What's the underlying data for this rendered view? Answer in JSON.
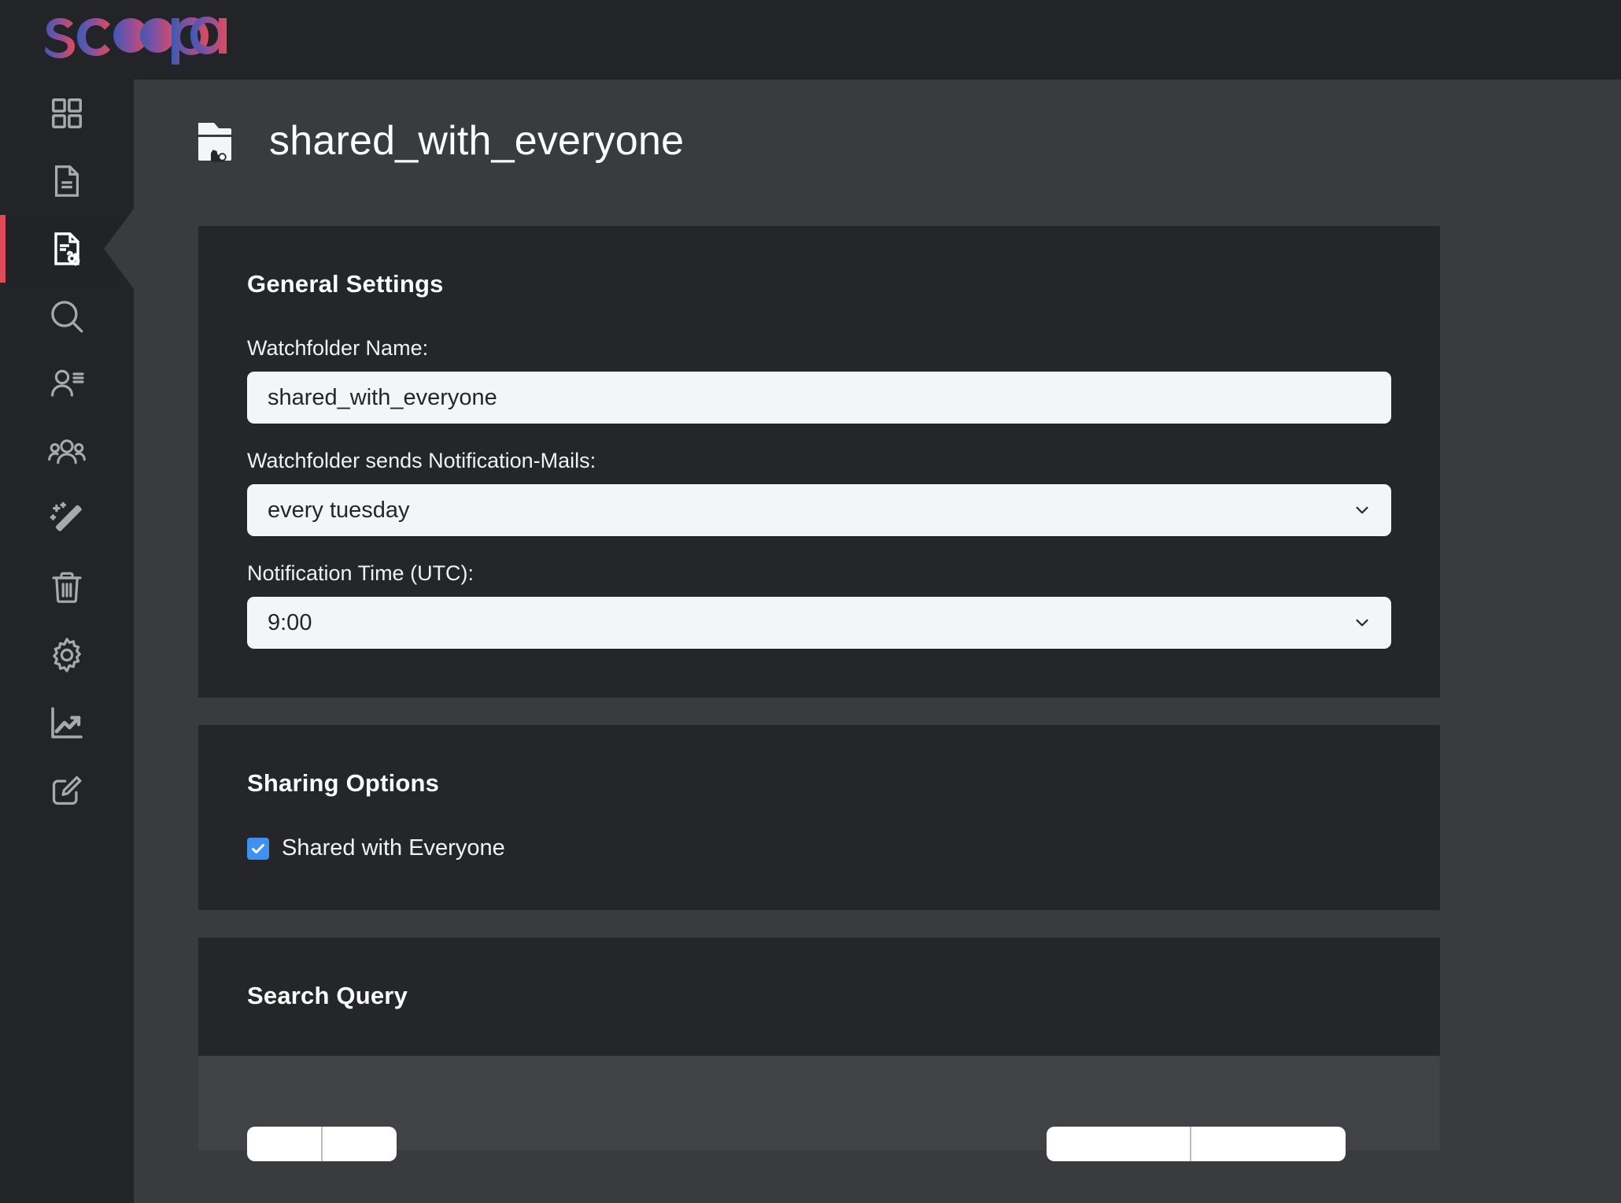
{
  "brand": {
    "name": "scoopa",
    "color_start": "#3b5bb5",
    "color_end": "#e04b5a"
  },
  "sidebar": {
    "items": [
      {
        "name": "dashboard",
        "icon": "grid-icon",
        "active": false
      },
      {
        "name": "documents",
        "icon": "document-icon",
        "active": false
      },
      {
        "name": "watchfolders",
        "icon": "document-gear-icon",
        "active": true
      },
      {
        "name": "search",
        "icon": "search-icon",
        "active": false
      },
      {
        "name": "user-profile",
        "icon": "user-list-icon",
        "active": false
      },
      {
        "name": "groups",
        "icon": "users-group-icon",
        "active": false
      },
      {
        "name": "magic",
        "icon": "magic-wand-icon",
        "active": false
      },
      {
        "name": "trash",
        "icon": "trash-icon",
        "active": false
      },
      {
        "name": "settings",
        "icon": "gear-icon",
        "active": false
      },
      {
        "name": "statistics",
        "icon": "chart-trend-up-icon",
        "active": false
      },
      {
        "name": "edit",
        "icon": "edit-square-icon",
        "active": false
      }
    ],
    "active_accent_color": "#e04b5a"
  },
  "header": {
    "icon": "watchfolder-icon",
    "title": "shared_with_everyone"
  },
  "general_settings": {
    "title": "General Settings",
    "watchfolder_name": {
      "label": "Watchfolder Name:",
      "value": "shared_with_everyone"
    },
    "notification_mails": {
      "label": "Watchfolder sends Notification-Mails:",
      "value": "every tuesday"
    },
    "notification_time": {
      "label": "Notification Time (UTC):",
      "value": "9:00"
    }
  },
  "sharing_options": {
    "title": "Sharing Options",
    "shared_with_everyone": {
      "label": "Shared with Everyone",
      "checked": true,
      "checkbox_color": "#3f90f0"
    }
  },
  "search_query": {
    "title": "Search Query"
  }
}
